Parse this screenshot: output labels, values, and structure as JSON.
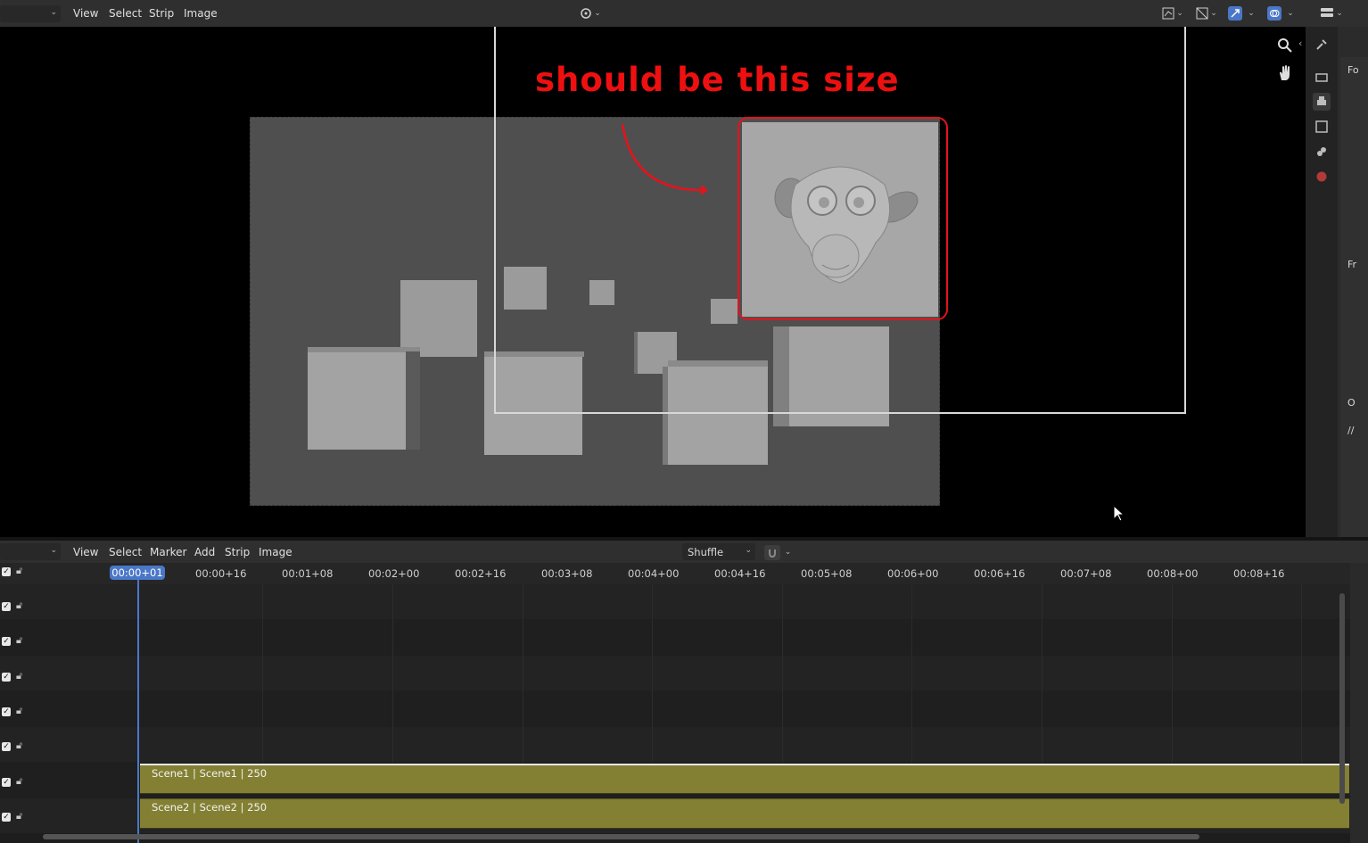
{
  "preview_header": {
    "menus": [
      "View",
      "Select",
      "Strip",
      "Image"
    ]
  },
  "annotation": {
    "text": "should be this size",
    "color": "#ee1010"
  },
  "sequencer_header": {
    "menus": [
      "View",
      "Select",
      "Marker",
      "Add",
      "Strip",
      "Image"
    ],
    "overlap_mode": "Shuffle"
  },
  "timeline": {
    "current_frame": "00:00+01",
    "ticks": [
      "00:00+16",
      "00:01+08",
      "00:02+00",
      "00:02+16",
      "00:03+08",
      "00:04+00",
      "00:04+16",
      "00:05+08",
      "00:06+00",
      "00:06+16",
      "00:07+08",
      "00:08+00",
      "00:08+16"
    ]
  },
  "strips": [
    {
      "label": "Scene1 | Scene1 | 250",
      "color": "#848033"
    },
    {
      "label": "Scene2 | Scene2 | 250",
      "color": "#848033"
    }
  ],
  "properties_panel": {
    "clipped_labels": [
      "Fo",
      "Fr",
      "O",
      "//"
    ]
  },
  "colors": {
    "accent": "#4a77c7",
    "strip": "#848033",
    "annotation": "#e5121c"
  }
}
